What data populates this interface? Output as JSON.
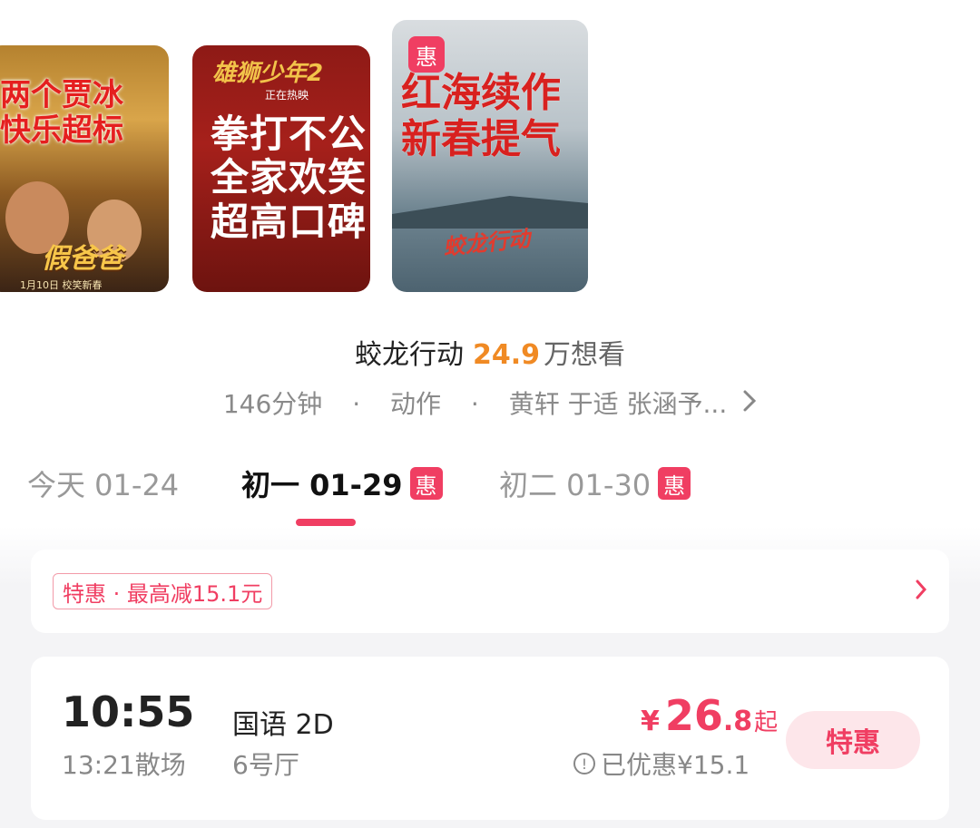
{
  "posters": [
    {
      "slogan": "两个贾冰\n快乐超标",
      "title": "假爸爸",
      "date_text": "1月10日 校笑新春"
    },
    {
      "slogan": "拳打不公\n全家欢笑\n超高口碑",
      "title": "雄狮少年2",
      "sub": "正在热映"
    },
    {
      "slogan": "红海续作\n新春提气",
      "title": "蛟龙行动",
      "badge": "惠"
    }
  ],
  "movie": {
    "name": "蛟龙行动",
    "want_count": "24.9",
    "want_suffix": "万想看",
    "duration": "146分钟",
    "genre": "动作",
    "cast": "黄轩  于适  张涵予...",
    "sep": "·"
  },
  "date_tabs": [
    {
      "label": "今天 01-24",
      "badge": "",
      "active": false
    },
    {
      "label": "初一 01-29",
      "badge": "惠",
      "active": true
    },
    {
      "label": "初二 01-30",
      "badge": "惠",
      "active": false
    }
  ],
  "promo": {
    "tag": "特惠 · 最高减15.1元",
    "chevron": "›"
  },
  "showtime": {
    "start": "10:55",
    "end": "13:21散场",
    "language": "国语 2D",
    "hall": "6号厅",
    "price_symbol": "¥",
    "price_int": "26",
    "price_dec": ".8",
    "price_suffix": "起",
    "saved": "已优惠¥15.1",
    "button": "特惠"
  },
  "colors": {
    "accent": "#f03e62",
    "orange": "#f08a24"
  }
}
